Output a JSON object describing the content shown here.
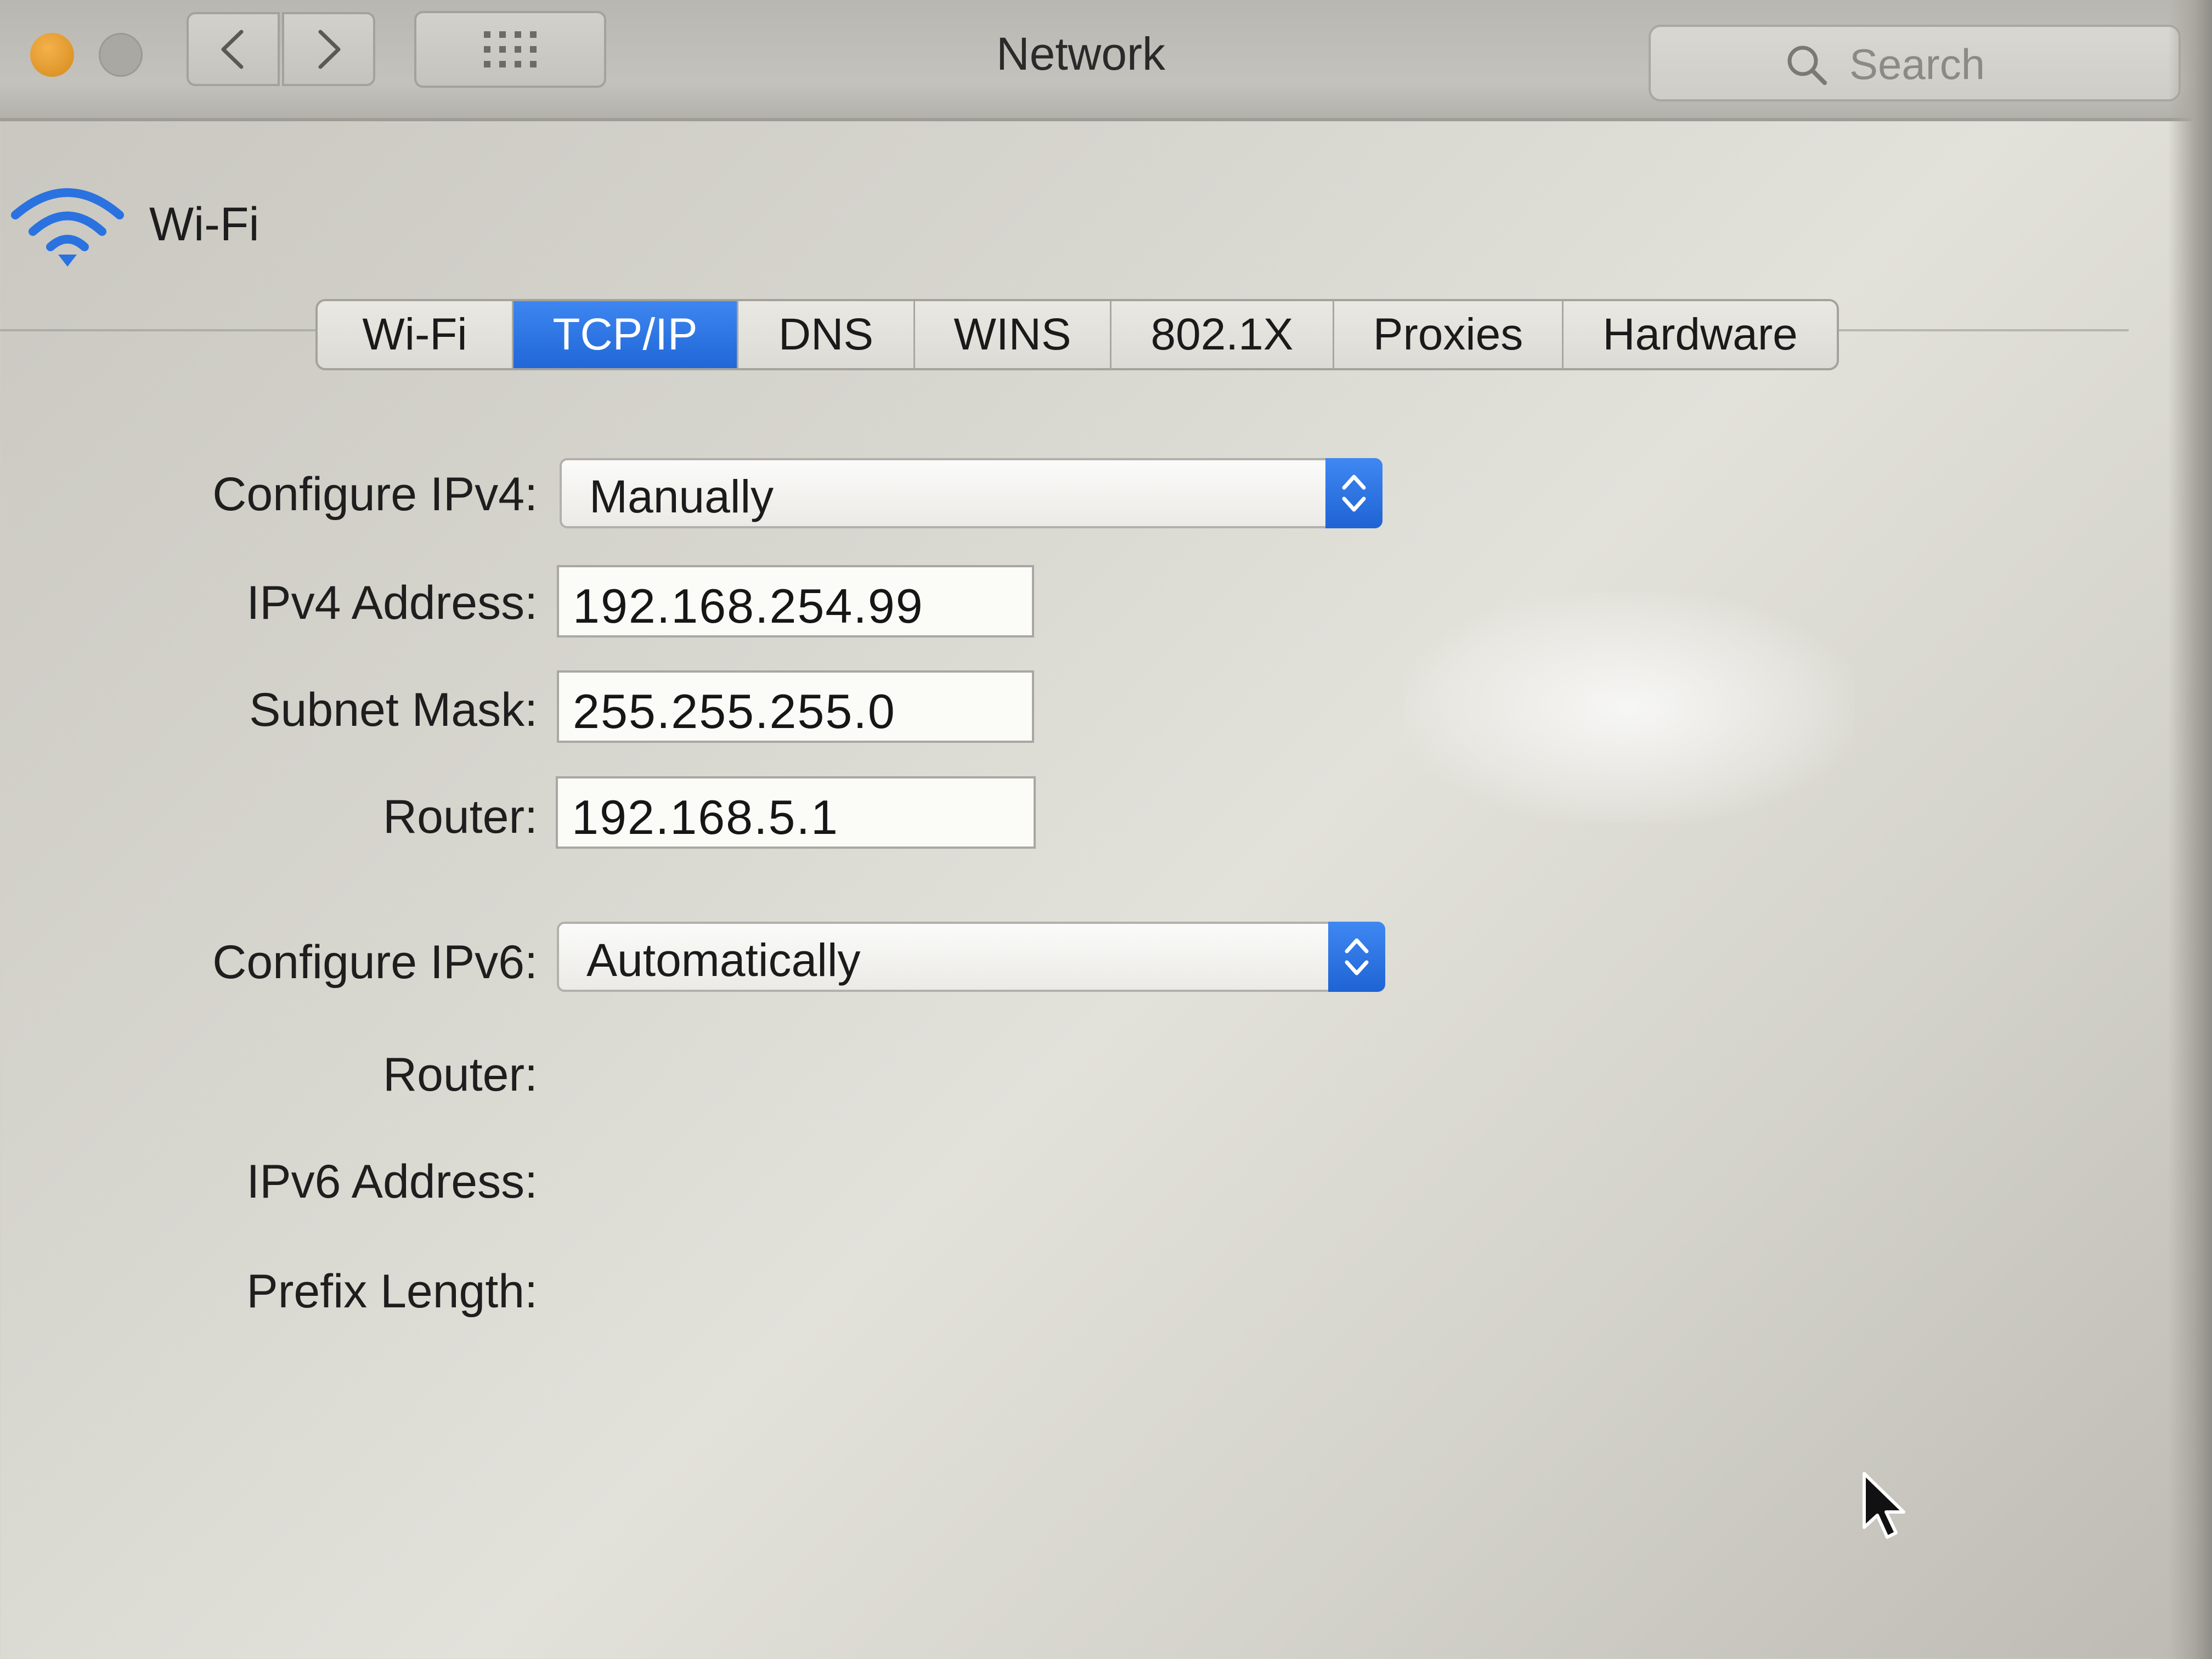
{
  "window": {
    "title": "Network",
    "search_placeholder": "Search"
  },
  "toolbar": {
    "back_icon": "chevron-left-icon",
    "forward_icon": "chevron-right-icon",
    "show_all_icon": "grid-icon"
  },
  "interface": {
    "name": "Wi-Fi",
    "icon": "wifi-icon"
  },
  "tabs": [
    {
      "label": "Wi-Fi",
      "selected": false
    },
    {
      "label": "TCP/IP",
      "selected": true
    },
    {
      "label": "DNS",
      "selected": false
    },
    {
      "label": "WINS",
      "selected": false
    },
    {
      "label": "802.1X",
      "selected": false
    },
    {
      "label": "Proxies",
      "selected": false
    },
    {
      "label": "Hardware",
      "selected": false
    }
  ],
  "ipv4": {
    "configure_label": "Configure IPv4:",
    "configure_value": "Manually",
    "address_label": "IPv4 Address:",
    "address_value": "192.168.254.99",
    "subnet_label": "Subnet Mask:",
    "subnet_value": "255.255.255.0",
    "router_label": "Router:",
    "router_value": "192.168.5.1"
  },
  "ipv6": {
    "configure_label": "Configure IPv6:",
    "configure_value": "Automatically",
    "router_label": "Router:",
    "address_label": "IPv6 Address:",
    "prefix_label": "Prefix Length:"
  },
  "colors": {
    "accent": "#2a72e0",
    "window_background": "#d7d6cf"
  }
}
